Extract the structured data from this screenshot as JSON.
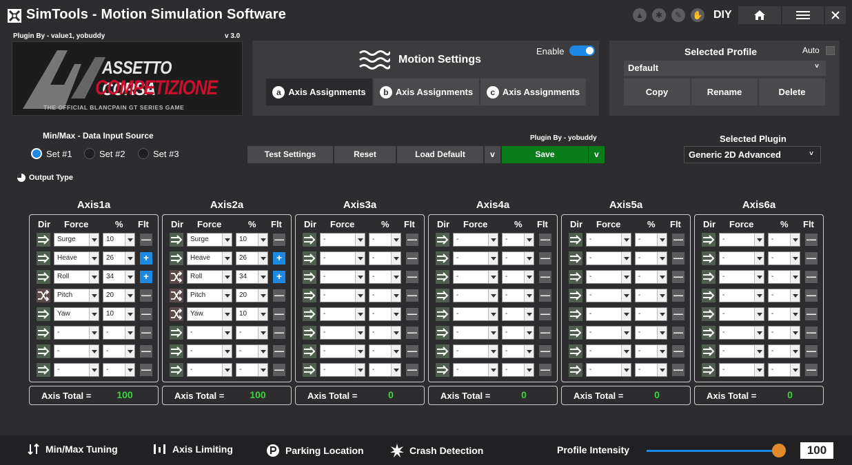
{
  "app": {
    "title": "SimTools - Motion Simulation Software",
    "mode": "DIY"
  },
  "plugin_info": {
    "plugin_by": "Plugin By - value1, yobuddy",
    "version": "v 3.0"
  },
  "banner": {
    "line1": "ASSETTO CORSA",
    "line2": "COMPETIZIONE",
    "subtitle": "THE OFFICIAL BLANCPAIN GT SERIES GAME"
  },
  "motion": {
    "title": "Motion Settings",
    "enable_label": "Enable",
    "enabled": true,
    "tabs": [
      {
        "badge": "a",
        "label": "Axis Assignments"
      },
      {
        "badge": "b",
        "label": "Axis Assignments"
      },
      {
        "badge": "c",
        "label": "Axis Assignments"
      }
    ]
  },
  "profile": {
    "title": "Selected Profile",
    "auto_label": "Auto",
    "selected": "Default",
    "buttons": [
      "Copy",
      "Rename",
      "Delete"
    ]
  },
  "data_source": {
    "label": "Min/Max - Data Input Source",
    "options": [
      "Set #1",
      "Set #2",
      "Set #3"
    ],
    "selected": "Set #1"
  },
  "output_type_label": "Output Type",
  "actions": {
    "plugin_by": "Plugin By - yobuddy",
    "test": "Test Settings",
    "reset": "Reset",
    "load_default": "Load Default",
    "chevron": "v",
    "save": "Save"
  },
  "selected_plugin": {
    "label": "Selected Plugin",
    "value": "Generic 2D Advanced"
  },
  "axis_headers": {
    "dir": "Dir",
    "force": "Force",
    "pct": "%",
    "flt": "Flt"
  },
  "axis_total_label": "Axis Total =",
  "axes": [
    {
      "name": "Axis1a",
      "total": "100",
      "rows": [
        {
          "dir": "normal",
          "force": "Surge",
          "pct": "10",
          "flt": "minus"
        },
        {
          "dir": "normal",
          "force": "Heave",
          "pct": "26",
          "flt": "plus"
        },
        {
          "dir": "normal",
          "force": "Roll",
          "pct": "34",
          "flt": "plus"
        },
        {
          "dir": "reverse",
          "force": "Pitch",
          "pct": "20",
          "flt": "minus"
        },
        {
          "dir": "normal",
          "force": "Yaw",
          "pct": "10",
          "flt": "minus"
        },
        {
          "dir": "normal",
          "force": "-",
          "pct": "-",
          "flt": "minus"
        },
        {
          "dir": "normal",
          "force": "-",
          "pct": "-",
          "flt": "minus"
        },
        {
          "dir": "normal",
          "force": "-",
          "pct": "-",
          "flt": "minus"
        }
      ]
    },
    {
      "name": "Axis2a",
      "total": "100",
      "rows": [
        {
          "dir": "normal",
          "force": "Surge",
          "pct": "10",
          "flt": "minus"
        },
        {
          "dir": "normal",
          "force": "Heave",
          "pct": "26",
          "flt": "plus"
        },
        {
          "dir": "reverse",
          "force": "Roll",
          "pct": "34",
          "flt": "plus"
        },
        {
          "dir": "reverse",
          "force": "Pitch",
          "pct": "20",
          "flt": "minus"
        },
        {
          "dir": "reverse",
          "force": "Yaw",
          "pct": "10",
          "flt": "minus"
        },
        {
          "dir": "normal",
          "force": "-",
          "pct": "-",
          "flt": "minus"
        },
        {
          "dir": "normal",
          "force": "-",
          "pct": "-",
          "flt": "minus"
        },
        {
          "dir": "normal",
          "force": "-",
          "pct": "-",
          "flt": "minus"
        }
      ]
    },
    {
      "name": "Axis3a",
      "total": "0",
      "rows": [
        {
          "dir": "normal",
          "force": "-",
          "pct": "-",
          "flt": "minus"
        },
        {
          "dir": "normal",
          "force": "-",
          "pct": "-",
          "flt": "minus"
        },
        {
          "dir": "normal",
          "force": "-",
          "pct": "-",
          "flt": "minus"
        },
        {
          "dir": "normal",
          "force": "-",
          "pct": "-",
          "flt": "minus"
        },
        {
          "dir": "normal",
          "force": "-",
          "pct": "-",
          "flt": "minus"
        },
        {
          "dir": "normal",
          "force": "-",
          "pct": "-",
          "flt": "minus"
        },
        {
          "dir": "normal",
          "force": "-",
          "pct": "-",
          "flt": "minus"
        },
        {
          "dir": "normal",
          "force": "-",
          "pct": "-",
          "flt": "minus"
        }
      ]
    },
    {
      "name": "Axis4a",
      "total": "0",
      "rows": [
        {
          "dir": "normal",
          "force": "-",
          "pct": "-",
          "flt": "minus"
        },
        {
          "dir": "normal",
          "force": "-",
          "pct": "-",
          "flt": "minus"
        },
        {
          "dir": "normal",
          "force": "-",
          "pct": "-",
          "flt": "minus"
        },
        {
          "dir": "normal",
          "force": "-",
          "pct": "-",
          "flt": "minus"
        },
        {
          "dir": "normal",
          "force": "-",
          "pct": "-",
          "flt": "minus"
        },
        {
          "dir": "normal",
          "force": "-",
          "pct": "-",
          "flt": "minus"
        },
        {
          "dir": "normal",
          "force": "-",
          "pct": "-",
          "flt": "minus"
        },
        {
          "dir": "normal",
          "force": "-",
          "pct": "-",
          "flt": "minus"
        }
      ]
    },
    {
      "name": "Axis5a",
      "total": "0",
      "rows": [
        {
          "dir": "normal",
          "force": "-",
          "pct": "-",
          "flt": "minus"
        },
        {
          "dir": "normal",
          "force": "-",
          "pct": "-",
          "flt": "minus"
        },
        {
          "dir": "normal",
          "force": "-",
          "pct": "-",
          "flt": "minus"
        },
        {
          "dir": "normal",
          "force": "-",
          "pct": "-",
          "flt": "minus"
        },
        {
          "dir": "normal",
          "force": "-",
          "pct": "-",
          "flt": "minus"
        },
        {
          "dir": "normal",
          "force": "-",
          "pct": "-",
          "flt": "minus"
        },
        {
          "dir": "normal",
          "force": "-",
          "pct": "-",
          "flt": "minus"
        },
        {
          "dir": "normal",
          "force": "-",
          "pct": "-",
          "flt": "minus"
        }
      ]
    },
    {
      "name": "Axis6a",
      "total": "0",
      "rows": [
        {
          "dir": "normal",
          "force": "-",
          "pct": "-",
          "flt": "minus"
        },
        {
          "dir": "normal",
          "force": "-",
          "pct": "-",
          "flt": "minus"
        },
        {
          "dir": "normal",
          "force": "-",
          "pct": "-",
          "flt": "minus"
        },
        {
          "dir": "normal",
          "force": "-",
          "pct": "-",
          "flt": "minus"
        },
        {
          "dir": "normal",
          "force": "-",
          "pct": "-",
          "flt": "minus"
        },
        {
          "dir": "normal",
          "force": "-",
          "pct": "-",
          "flt": "minus"
        },
        {
          "dir": "normal",
          "force": "-",
          "pct": "-",
          "flt": "minus"
        },
        {
          "dir": "normal",
          "force": "-",
          "pct": "-",
          "flt": "minus"
        }
      ]
    }
  ],
  "bottom_bar": {
    "items": [
      "Min/Max Tuning",
      "Axis Limiting",
      "Parking Location",
      "Crash Detection"
    ],
    "intensity_label": "Profile Intensity",
    "intensity_value": "100",
    "intensity_fraction": 0.96
  },
  "colors": {
    "accent_blue": "#1e88e5",
    "save_green": "#0a7d1a",
    "total_green": "#3cd43c",
    "slider_knob": "#e08a2b"
  }
}
